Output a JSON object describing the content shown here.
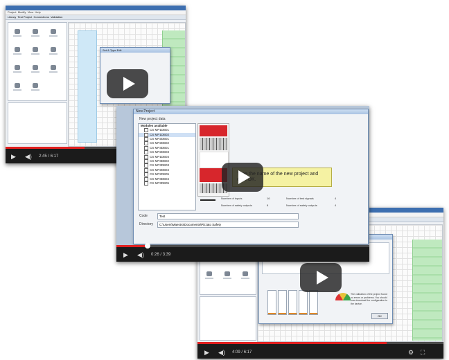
{
  "videos": [
    {
      "id": "video-1",
      "time_current": "2:45",
      "time_total": "6:17",
      "progress": 0.44,
      "app": {
        "menu": [
          "Project",
          "Modify",
          "View",
          "Help"
        ],
        "tabs": [
          "Library",
          "Test Project",
          "Connections",
          "Validation"
        ]
      },
      "dialog": {
        "title": "Set & Type Edit"
      }
    },
    {
      "id": "video-2",
      "time_current": "0:26",
      "time_total": "3:39",
      "progress": 0.12,
      "dialog": {
        "title": "New Project",
        "subtitle": "New project data",
        "list_header": "Modules available",
        "modules": [
          "CS MP1DB01",
          "CS MP1DB02",
          "CS MP2DB01",
          "CS MP2DB02",
          "CS MP3DB01",
          "CS MP2DB03",
          "CS MP1DB04",
          "CS MP3DB02",
          "CS MP3DB03",
          "CS MP2DB04",
          "CS MP2DB05",
          "CS MP3DB04",
          "CS MP3DB05"
        ],
        "code_label": "Code",
        "code_value": "Test",
        "directory_label": "Directory",
        "directory_value": "C:\\Users\\Maestro\\Documents\\Pizzato Safety",
        "callout": "Type the name of the new project and click OK.",
        "info_rows": [
          {
            "label": "Number of inputs",
            "value": "16",
            "label2": "Number of test signals",
            "value2": "4"
          },
          {
            "label": "Number of safety outputs",
            "value": "8",
            "label2": "Number of safety outputs",
            "value2": "4"
          }
        ]
      }
    },
    {
      "id": "video-3",
      "time_current": "4:09",
      "time_total": "6:17",
      "progress": 0.77,
      "app": {
        "menu": [
          "Project",
          "Modify",
          "View",
          "Help"
        ],
        "tabs": [
          "Library",
          "Test Project",
          "Connections",
          "Validation"
        ]
      },
      "dialog": {
        "title": "Validation of the project",
        "lines": [
          "Check the project",
          "Inputs check",
          "Outputs check",
          "Logic check",
          "Validation completed"
        ],
        "note": "The validation of the project found no errors or problems. You should now download the configuration to the device.",
        "ok_label": "OK"
      }
    }
  ],
  "colors": {
    "player_bar": "#1b1b1b",
    "progress": "#e02020",
    "module_red": "#d7262c",
    "callout_bg": "#f5f2a3",
    "canvas_green": "#bfe9bf"
  }
}
